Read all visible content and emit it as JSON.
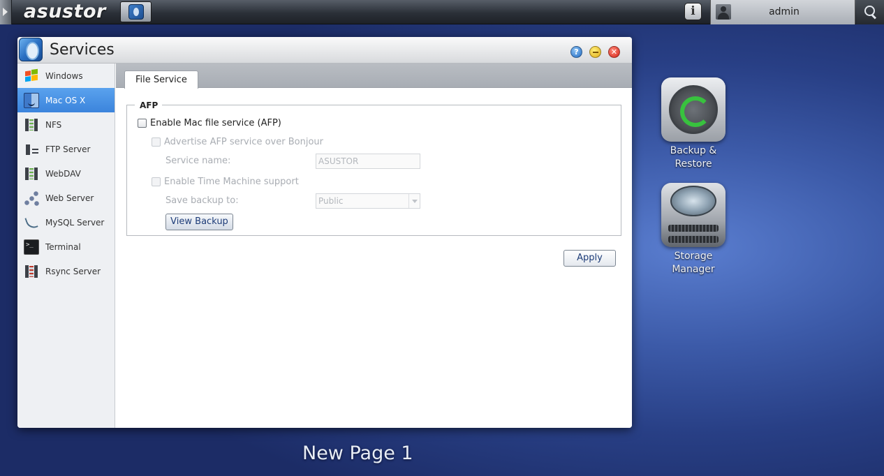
{
  "topbar": {
    "logo": "asustor",
    "username": "admin"
  },
  "desktop": {
    "icons": [
      {
        "label_line1": "Backup &",
        "label_line2": "Restore"
      },
      {
        "label_line1": "Storage",
        "label_line2": "Manager"
      }
    ],
    "page_label": "New Page 1"
  },
  "window": {
    "title": "Services",
    "controls": {
      "help": "?"
    },
    "sidebar": {
      "active_index": 1,
      "items": [
        {
          "label": "Windows",
          "icon": "windows-icon"
        },
        {
          "label": "Mac OS X",
          "icon": "mac-os-icon"
        },
        {
          "label": "NFS",
          "icon": "server-icon"
        },
        {
          "label": "FTP Server",
          "icon": "ftp-icon"
        },
        {
          "label": "WebDAV",
          "icon": "server-icon"
        },
        {
          "label": "Web Server",
          "icon": "web-server-icon"
        },
        {
          "label": "MySQL Server",
          "icon": "mysql-icon"
        },
        {
          "label": "Terminal",
          "icon": "terminal-icon"
        },
        {
          "label": "Rsync Server",
          "icon": "rsync-icon"
        }
      ]
    },
    "tabs": [
      {
        "label": "File Service",
        "active": true
      }
    ],
    "afp": {
      "legend": "AFP",
      "enable_label": "Enable Mac file service (AFP)",
      "enable_checked": false,
      "bonjour_label": "Advertise AFP service over Bonjour",
      "bonjour_checked": false,
      "service_name_label": "Service name:",
      "service_name_value": "ASUSTOR",
      "time_machine_label": "Enable Time Machine support",
      "time_machine_checked": false,
      "save_backup_label": "Save backup to:",
      "save_backup_value": "Public",
      "view_backup_button": "View Backup"
    },
    "apply_button": "Apply"
  }
}
